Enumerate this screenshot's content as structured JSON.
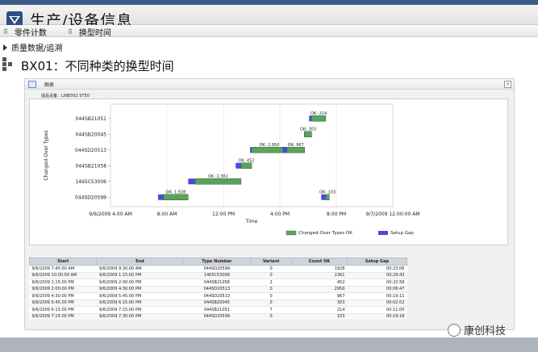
{
  "header": {
    "title": "生产/设备信息"
  },
  "menu": {
    "items": [
      {
        "label": "零件计数"
      },
      {
        "label": "换型时间"
      }
    ]
  },
  "section": {
    "label": "质量数据/追溯"
  },
  "main": {
    "title": "BX01：不同种类的换型时间"
  },
  "panel": {
    "tab_label": "图表",
    "mo_label": "成品设备：LINE002 ST50"
  },
  "chart_data": {
    "type": "gantt",
    "ylabel": "Changed-Over Types",
    "xlabel": "Time",
    "x_ticks": [
      "9/6/2009 4:00 AM",
      "8:00 AM",
      "12:00 PM",
      "4:00 PM",
      "8:00 PM",
      "9/7/2009 12:00:00 AM"
    ],
    "categories": [
      "044SB21051",
      "044SB20045",
      "044SD20513",
      "044SB21058",
      "1465C53006",
      "044SD20599"
    ],
    "legend": [
      {
        "label": "Changed-Over Types OK",
        "color": "#5aa35a"
      },
      {
        "label": "Setup Gap",
        "color": "#4a4adc"
      }
    ],
    "bars": [
      {
        "type": "044SD20599",
        "start": "7:45 AM",
        "end": "9:30 AM",
        "setup_gap": "00:23:06",
        "label": "OK: 1,928"
      },
      {
        "type": "1465C53006",
        "start": "10:00 AM",
        "end": "1:15 PM",
        "setup_gap": "00:29:43",
        "label": "OK: 2,361"
      },
      {
        "type": "044SB21058",
        "start": "1:15 PM",
        "end": "2:00 PM",
        "setup_gap": "00:22:58",
        "label": "OK: 452"
      },
      {
        "type": "044SD20513",
        "start": "2:00 PM",
        "end": "4:30 PM",
        "setup_gap": "00:06:47",
        "label": "OK: 2,950"
      },
      {
        "type": "044SD20513",
        "start": "4:30 PM",
        "end": "5:45 PM",
        "setup_gap": "00:19:11",
        "label": "OK: 967"
      },
      {
        "type": "044SB20045",
        "start": "5:45 PM",
        "end": "6:15 PM",
        "setup_gap": "00:02:02",
        "label": "OK: 303"
      },
      {
        "type": "044SB21051",
        "start": "6:15 PM",
        "end": "7:15 PM",
        "setup_gap": "00:11:00",
        "label": "OK: 214"
      },
      {
        "type": "044SD20599",
        "start": "7:15 PM",
        "end": "7:30 PM",
        "setup_gap": "00:19:18",
        "label": "OK: 103"
      }
    ]
  },
  "table": {
    "columns": [
      "Start",
      "End",
      "Type Number",
      "Variant",
      "Count OK",
      "Setup Gap"
    ],
    "rows": [
      [
        "9/6/2009 7:45:00 AM",
        "9/6/2009 9:30:00 AM",
        "044SD20599",
        "0",
        "1928",
        "00:23:06"
      ],
      [
        "9/6/2009 10:00:00 AM",
        "9/6/2009 1:15:00 PM",
        "1465C53006",
        "0",
        "2361",
        "00:29:43"
      ],
      [
        "9/6/2009 1:15:00 PM",
        "9/6/2009 2:00:00 PM",
        "044SB21058",
        "2",
        "452",
        "00:22:58"
      ],
      [
        "9/6/2009 2:00:00 PM",
        "9/6/2009 4:30:00 PM",
        "044SD20513",
        "0",
        "2950",
        "00:06:47"
      ],
      [
        "9/6/2009 4:30:00 PM",
        "9/6/2009 5:45:00 PM",
        "044SD20513",
        "0",
        "967",
        "00:19:11"
      ],
      [
        "9/6/2009 5:45:00 PM",
        "9/6/2009 6:15:00 PM",
        "044SB20045",
        "0",
        "303",
        "00:02:02"
      ],
      [
        "9/6/2009 6:15:00 PM",
        "9/6/2009 7:15:00 PM",
        "044SB21051",
        "7",
        "214",
        "00:11:00"
      ],
      [
        "9/6/2009 7:15:00 PM",
        "9/6/2009 7:30:00 PM",
        "044SD20599",
        "0",
        "103",
        "00:19:18"
      ]
    ]
  },
  "watermark": {
    "text": "康创科技"
  },
  "colors": {
    "topbar": "#3c5b8a",
    "ok": "#5aa35a",
    "gap": "#4a4adc",
    "footer": "#aeb4bd"
  }
}
